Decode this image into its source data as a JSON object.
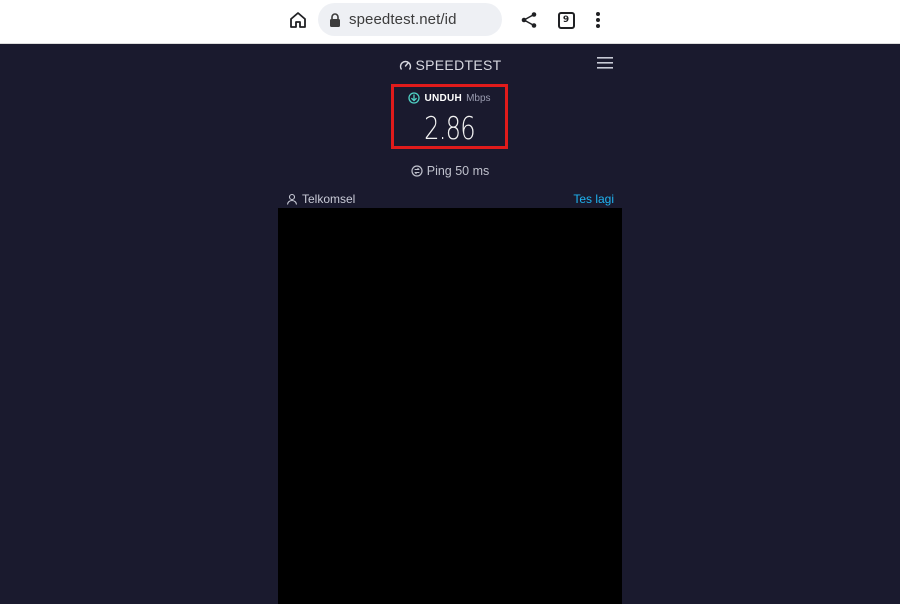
{
  "browser": {
    "url": "speedtest.net/id",
    "tab_count": "9"
  },
  "page": {
    "logo_text": "SPEEDTEST",
    "download": {
      "label": "UNDUH",
      "unit": "Mbps",
      "value": "2.86"
    },
    "ping_text": "Ping 50 ms",
    "provider": "Telkomsel",
    "retest_label": "Tes lagi"
  },
  "colors": {
    "background": "#1a1a2e",
    "highlight": "#e01b1b",
    "accent": "#1fb3f0",
    "download_icon": "#4fd1c5"
  },
  "icons": {
    "home": "home-icon",
    "lock": "lock-icon",
    "share": "share-icon",
    "tabs": "tabs-icon",
    "menu": "more-vert-icon",
    "logo": "gauge-icon",
    "hamburger": "hamburger-menu-icon",
    "download": "download-arrow-icon",
    "ping": "ping-icon",
    "person": "person-icon"
  }
}
